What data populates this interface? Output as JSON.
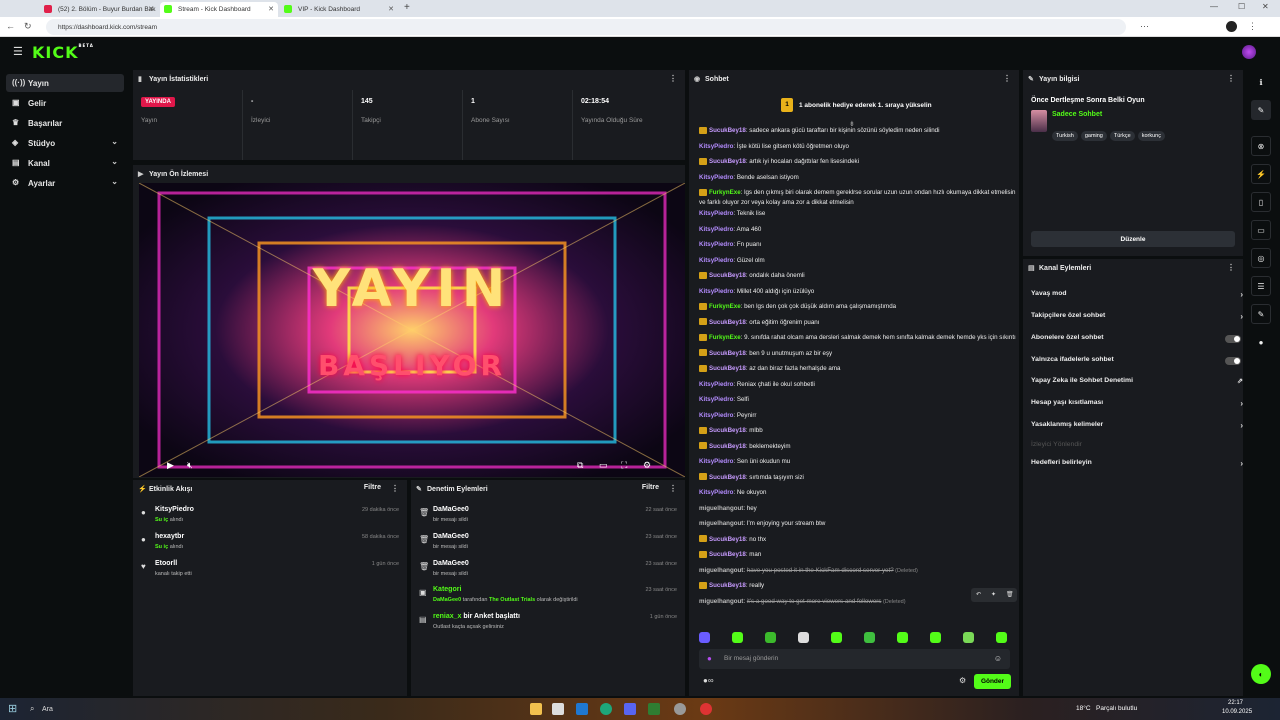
{
  "browser": {
    "tabs": [
      {
        "label": "(52) 2. Bölüm - Buyur Burdan Bak",
        "color": "#e0204a",
        "active": false
      },
      {
        "label": "Stream - Kick Dashboard",
        "color": "#53fc18",
        "active": true
      },
      {
        "label": "VIP - Kick Dashboard",
        "color": "#53fc18",
        "active": false
      }
    ],
    "url": "https://dashboard.kick.com/stream"
  },
  "app": {
    "logo": "KICK",
    "logo_tag": "BETA",
    "accent": "#53fc18"
  },
  "sidebar": {
    "items": [
      {
        "label": "Yayın",
        "icon": "broadcast-icon"
      },
      {
        "label": "Gelir",
        "icon": "money-icon"
      },
      {
        "label": "Başarılar",
        "icon": "trophy-icon"
      },
      {
        "label": "Stüdyo",
        "icon": "studio-icon"
      },
      {
        "label": "Kanal",
        "icon": "channel-icon"
      },
      {
        "label": "Ayarlar",
        "icon": "gear-icon"
      }
    ]
  },
  "stats": {
    "title": "Yayın İstatistikleri",
    "cells": [
      {
        "value": "YAYINDA",
        "label": "Yayın"
      },
      {
        "value": "-",
        "label": "İzleyici"
      },
      {
        "value": "145",
        "label": "Takipçi"
      },
      {
        "value": "1",
        "label": "Abone Sayısı"
      },
      {
        "value": "02:18:54",
        "label": "Yayında Olduğu Süre"
      }
    ]
  },
  "preview": {
    "title": "Yayın Ön İzlemesi",
    "line1": "YAYIN",
    "line2": "BAŞLIYOR"
  },
  "activity": {
    "title": "Etkinlik Akışı",
    "filter": "Filtre",
    "items": [
      {
        "name": "KitsyPiedro",
        "sub_prefix": "Su iç",
        "sub": "alındı",
        "time": "29 dakika önce"
      },
      {
        "name": "hexaytbr",
        "sub_prefix": "Su iç",
        "sub": "alındı",
        "time": "58 dakika önce"
      },
      {
        "name": "Etoorll",
        "sub_prefix": "",
        "sub": "kanalı takip etti",
        "time": "1 gün önce"
      }
    ]
  },
  "moderation": {
    "title": "Denetim Eylemleri",
    "filter": "Filtre",
    "items": [
      {
        "name": "DaMaGee0",
        "sub": "bir mesajı sildi",
        "time": "22 saat önce"
      },
      {
        "name": "DaMaGee0",
        "sub": "bir mesajı sildi",
        "time": "23 saat önce"
      },
      {
        "name": "DaMaGee0",
        "sub": "bir mesajı sildi",
        "time": "23 saat önce"
      },
      {
        "name": "Kategori",
        "sub_user": "DaMaGee0",
        "sub_mid": "tarafından",
        "sub_game": "The Outlast Trials",
        "sub": "olarak değiştirildi",
        "time": "23 saat önce"
      },
      {
        "name": "reniax_x",
        "name_suffix": "bir Anket başlattı",
        "sub": "Outlast kaçta açsak gelirsiniz",
        "time": "1 gün önce"
      }
    ]
  },
  "chat": {
    "title": "Sohbet",
    "pinned_badge": "1",
    "pinned": "1 abonelik hediye ederek 1. sıraya yükselin",
    "messages": [
      {
        "user": "SucukBey18",
        "crown": true,
        "text": "sadece ankara gücü taraftarı bir kişinin sözünü söyledim neden silindi"
      },
      {
        "user": "KitsyPiedro",
        "crown": false,
        "text": "İşte kötü lise gitsem kötü öğretmen oluyo"
      },
      {
        "user": "SucukBey18",
        "crown": true,
        "text": "artık iyi hocaları dağıttılar fen lisesindeki"
      },
      {
        "user": "KitsyPiedro",
        "crown": false,
        "text": "Bende aselsan istiyom"
      },
      {
        "user": "FurkynExe",
        "crown": true,
        "text": "lgs den çıkmış biri olarak demem gereklrse sorular uzun uzun ondan hızlı okumaya dikkat etmelisin ve farklı oluyor zor veya kolay ama zor a dikkat etmelisin"
      },
      {
        "user": "KitsyPiedro",
        "crown": false,
        "text": "Teknik lise"
      },
      {
        "user": "KitsyPiedro",
        "crown": false,
        "text": "Ama 460"
      },
      {
        "user": "KitsyPiedro",
        "crown": false,
        "text": "Fn puanı"
      },
      {
        "user": "KitsyPiedro",
        "crown": false,
        "text": "Güzel olm"
      },
      {
        "user": "SucukBey18",
        "crown": true,
        "text": "ondalık daha önemli"
      },
      {
        "user": "KitsyPiedro",
        "crown": false,
        "text": "Millet 400 aldığı için üzülüyo"
      },
      {
        "user": "FurkynExe",
        "crown": true,
        "text": "ben lgs den çok çok düşük aldım ama çalışmamıştımda"
      },
      {
        "user": "SucukBey18",
        "crown": true,
        "text": "orta eğitim öğrenim puanı"
      },
      {
        "user": "FurkynExe",
        "crown": true,
        "text": "9. sınıfda rahat olcam ama dersleri salmak demek hem sınıfta kalmak demek hemde yks için sıkıntı"
      },
      {
        "user": "SucukBey18",
        "crown": true,
        "text": "ben 9 u unutmuşum az bir eşy"
      },
      {
        "user": "SucukBey18",
        "crown": true,
        "text": "az dan biraz fazla herhalşde ama"
      },
      {
        "user": "KitsyPiedro",
        "crown": false,
        "text": "Reniax çhati ile okul sohbetli"
      },
      {
        "user": "KitsyPiedro",
        "crown": false,
        "text": "Selfi"
      },
      {
        "user": "KitsyPiedro",
        "crown": false,
        "text": "Peynirr"
      },
      {
        "user": "SucukBey18",
        "crown": true,
        "text": "mlbb"
      },
      {
        "user": "SucukBey18",
        "crown": true,
        "text": "beklemekteyim"
      },
      {
        "user": "KitsyPiedro",
        "crown": false,
        "text": "Sen üni okudun mu"
      },
      {
        "user": "SucukBey18",
        "crown": true,
        "text": "sırtımda taşıyım sizi"
      },
      {
        "user": "KitsyPiedro",
        "crown": false,
        "text": "Ne okuyon"
      },
      {
        "user": "miguelhangout",
        "crown": false,
        "text": "hey"
      },
      {
        "user": "miguelhangout",
        "crown": false,
        "text": "I'm enjoying your stream btw"
      },
      {
        "user": "SucukBey18",
        "crown": true,
        "text": "no thx"
      },
      {
        "user": "SucukBey18",
        "crown": true,
        "text": "man"
      },
      {
        "user": "miguelhangout",
        "crown": false,
        "text": "have you posted it in the KickFam discord server yet?",
        "deleted": true
      },
      {
        "user": "SucukBey18",
        "crown": true,
        "text": "really"
      },
      {
        "user": "miguelhangout",
        "crown": false,
        "text": "it's a good way to get more viewers and followers",
        "deleted": true
      }
    ],
    "deleted_label": "(Deleted)",
    "input_placeholder": "Bir mesaj gönderin",
    "send_label": "Gönder"
  },
  "stream_info": {
    "title": "Yayın bilgisi",
    "stream_title": "Önce Dertleşme Sonra Belki Oyun",
    "category": "Sadece Sohbet",
    "tags": [
      "Turkish",
      "gaming",
      "Türkçe",
      "korkunç"
    ],
    "edit_label": "Düzenle"
  },
  "channel_actions": {
    "title": "Kanal Eylemleri",
    "items": [
      {
        "label": "Yavaş mod",
        "type": "chevron"
      },
      {
        "label": "Takipçilere özel sohbet",
        "type": "chevron"
      },
      {
        "label": "Abonelere özel sohbet",
        "type": "toggle"
      },
      {
        "label": "Yalnızca ifadelerle sohbet",
        "type": "toggle"
      },
      {
        "label": "Yapay Zeka ile Sohbet Denetimi",
        "type": "external"
      },
      {
        "label": "Hesap yaşı kısıtlaması",
        "type": "chevron"
      },
      {
        "label": "Yasaklanmış kelimeler",
        "type": "chevron"
      },
      {
        "label": "İzleyici Yönlendir",
        "type": "disabled"
      },
      {
        "label": "Hedefleri belirleyin",
        "type": "chevron"
      }
    ]
  },
  "taskbar": {
    "search": "Ara",
    "weather": "18°C",
    "weather_desc": "Parçalı bulutlu",
    "time": "22:17",
    "date": "10.09.2025"
  }
}
